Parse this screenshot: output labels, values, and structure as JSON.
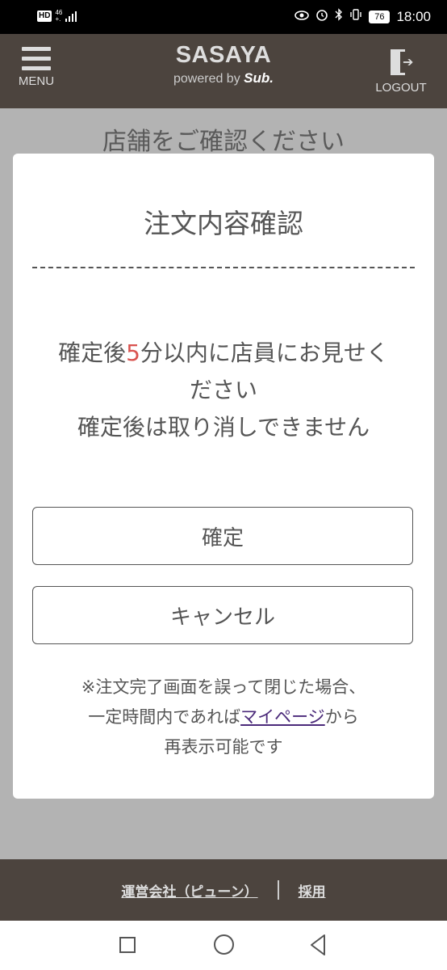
{
  "status_bar": {
    "hd": "HD",
    "network_top": "46",
    "network_bottom": "+.",
    "battery": "76",
    "time": "18:00"
  },
  "header": {
    "menu_label": "MENU",
    "brand_title": "SASAYA",
    "brand_sub_prefix": "powered by ",
    "brand_sub_name": "Sub.",
    "logout_label": "LOGOUT"
  },
  "background": {
    "title": "店舗をご確認ください"
  },
  "modal": {
    "title": "注文内容確認",
    "msg_part1": "確定後",
    "msg_highlight": "5",
    "msg_part2": "分以内に店員にお見せく",
    "msg_line2": "ださい",
    "msg_line3": "確定後は取り消しできません",
    "confirm_label": "確定",
    "cancel_label": "キャンセル",
    "note_line1": "※注文完了画面を誤って閉じた場合、",
    "note_line2_prefix": "一定時間内であれば",
    "note_link": "マイページ",
    "note_line2_suffix": "から",
    "note_line3": "再表示可能です",
    "highlight_color": "#d9534f"
  },
  "footer": {
    "company_link": "運営会社（ピューン）",
    "recruit_link": "採用"
  },
  "nav_icons": [
    "recent-apps-icon",
    "home-icon",
    "back-icon"
  ]
}
